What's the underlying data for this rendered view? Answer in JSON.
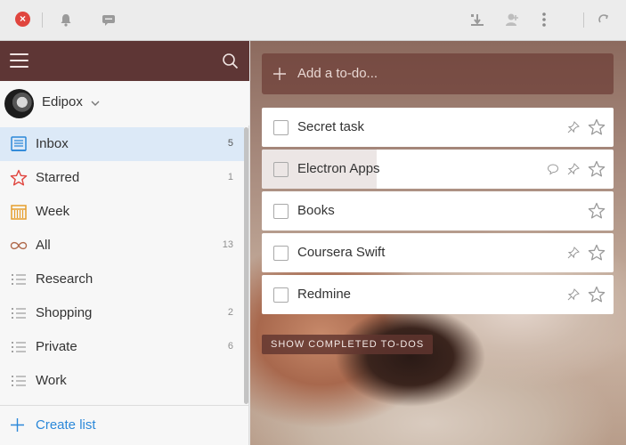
{
  "colors": {
    "sidebar_header": "#5e3635",
    "active_list": "#dce9f7",
    "accent_blue": "#2b88d9",
    "starred_red": "#e0453e",
    "week_orange": "#e59d2c",
    "close_red": "#e0453e"
  },
  "titlebar": {
    "close_icon": "close-icon",
    "icons": [
      "bell-icon",
      "comment-icon",
      "sort-icon",
      "add-user-icon",
      "more-options-icon",
      "sync-icon"
    ]
  },
  "sidebar": {
    "user": {
      "name": "Edipox"
    },
    "lists": [
      {
        "label": "Inbox",
        "count": "5",
        "icon": "inbox-icon",
        "active": true
      },
      {
        "label": "Starred",
        "count": "1",
        "icon": "star-icon"
      },
      {
        "label": "Week",
        "count": "",
        "icon": "calendar-week-icon"
      },
      {
        "label": "All",
        "count": "13",
        "icon": "infinity-icon"
      },
      {
        "label": "Research",
        "count": "",
        "icon": "list-icon"
      },
      {
        "label": "Shopping",
        "count": "2",
        "icon": "list-icon"
      },
      {
        "label": "Private",
        "count": "6",
        "icon": "list-icon"
      },
      {
        "label": "Work",
        "count": "",
        "icon": "list-icon"
      }
    ],
    "create_list_label": "Create list"
  },
  "main": {
    "add_placeholder": "Add a to-do...",
    "tasks": [
      {
        "title": "Secret task",
        "pinned": true,
        "comment": false
      },
      {
        "title": "Electron Apps",
        "pinned": true,
        "comment": true
      },
      {
        "title": "Books",
        "pinned": false,
        "comment": false
      },
      {
        "title": "Coursera Swift",
        "pinned": true,
        "comment": false
      },
      {
        "title": "Redmine",
        "pinned": true,
        "comment": false
      }
    ],
    "show_completed_label": "SHOW COMPLETED TO-DOS"
  }
}
